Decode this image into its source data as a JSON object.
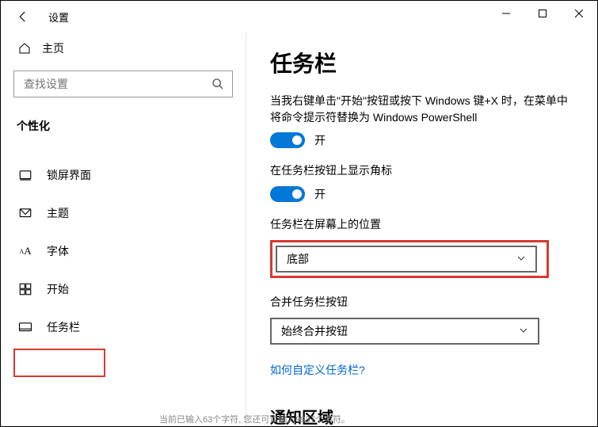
{
  "title": "设置",
  "home_label": "主页",
  "search_placeholder": "查找设置",
  "section_head": "个性化",
  "nav": [
    {
      "icon": "lock",
      "label": "锁屏界面"
    },
    {
      "icon": "theme",
      "label": "主题"
    },
    {
      "icon": "font",
      "label": "字体"
    },
    {
      "icon": "start",
      "label": "开始"
    },
    {
      "icon": "taskbar",
      "label": "任务栏"
    }
  ],
  "content": {
    "page_title": "任务栏",
    "desc1": "当我右键单击\"开始\"按钮或按下 Windows 键+X 时，在菜单中将命令提示符替换为 Windows PowerShell",
    "toggle1_state": "开",
    "label2": "在任务栏按钮上显示角标",
    "toggle2_state": "开",
    "pos_label": "任务栏在屏幕上的位置",
    "pos_value": "底部",
    "combine_label": "合并任务栏按钮",
    "combine_value": "始终合并按钮",
    "link": "如何自定义任务栏?",
    "section2": "通知区域"
  },
  "footer_fragment": "当前已输入63个字符, 您还可以输入9937个字符。"
}
